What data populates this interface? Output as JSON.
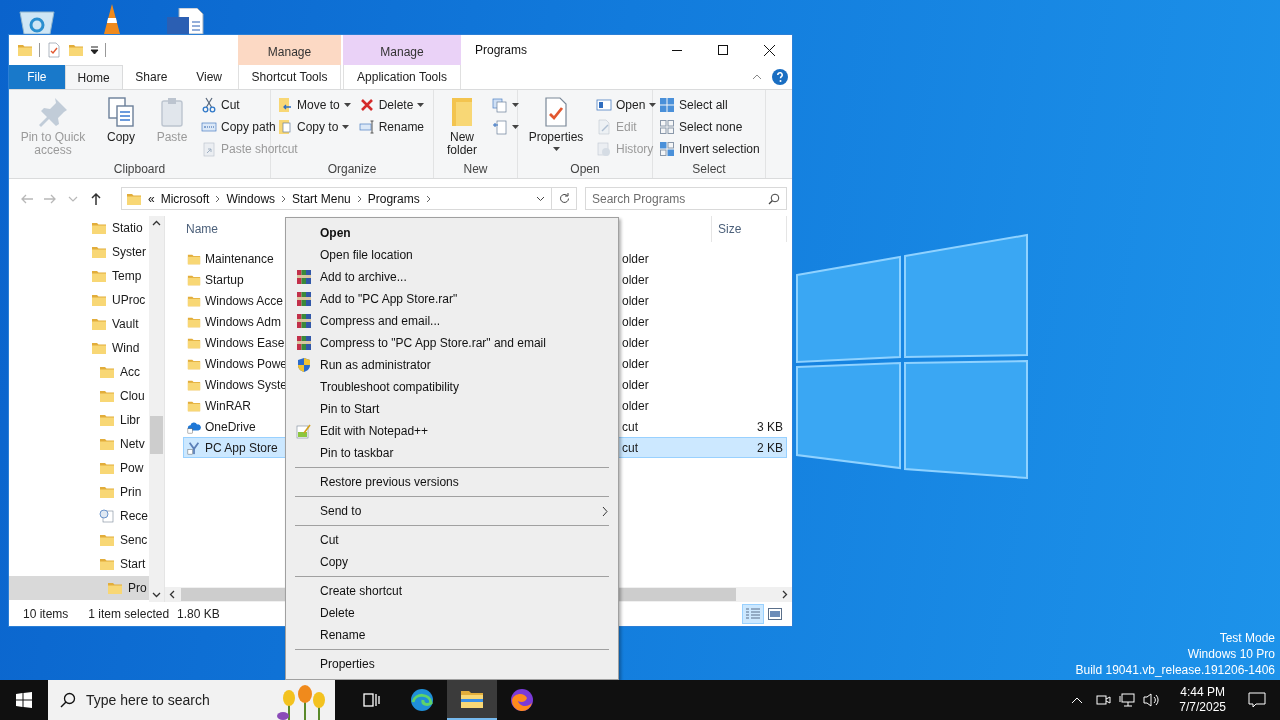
{
  "explorer": {
    "title": "Programs",
    "tabs": [
      {
        "label": "File",
        "kind": "file",
        "selected": false
      },
      {
        "label": "Home",
        "kind": "tab",
        "selected": true
      },
      {
        "label": "Share",
        "kind": "tab",
        "selected": false
      },
      {
        "label": "View",
        "kind": "tab",
        "selected": false
      }
    ],
    "contextual_tabs": [
      {
        "group": "Manage",
        "label": "Shortcut Tools",
        "color": "#fcd9c4",
        "selected": false
      },
      {
        "group": "Manage",
        "label": "Application Tools",
        "color": "#ead2f7",
        "selected": false
      }
    ],
    "ribbon": [
      {
        "label": "Clipboard",
        "columns": [
          [
            {
              "kind": "large",
              "label": "Pin to Quick access",
              "disabled": true,
              "dropdown": false
            }
          ],
          [
            {
              "kind": "large",
              "label": "Copy",
              "disabled": false,
              "dropdown": false
            }
          ],
          [
            {
              "kind": "large",
              "label": "Paste",
              "disabled": true,
              "dropdown": false
            }
          ],
          [
            {
              "kind": "small",
              "label": "Cut",
              "disabled": false,
              "dropdown": false
            },
            {
              "kind": "small",
              "label": "Copy path",
              "disabled": false,
              "dropdown": false
            },
            {
              "kind": "small",
              "label": "Paste shortcut",
              "disabled": true,
              "dropdown": false
            }
          ]
        ]
      },
      {
        "label": "Organize",
        "columns": [
          [
            {
              "kind": "small",
              "label": "Move to",
              "disabled": false,
              "dropdown": true
            },
            {
              "kind": "small",
              "label": "Copy to",
              "disabled": false,
              "dropdown": true
            }
          ],
          [
            {
              "kind": "small",
              "label": "Delete",
              "disabled": false,
              "dropdown": true
            },
            {
              "kind": "small",
              "label": "Rename",
              "disabled": false,
              "dropdown": false
            }
          ]
        ]
      },
      {
        "label": "New",
        "columns": [
          [
            {
              "kind": "large",
              "label": "New folder",
              "disabled": false,
              "dropdown": false
            }
          ],
          [
            {
              "kind": "small",
              "disabled": false,
              "dropdown": true
            },
            {
              "kind": "small",
              "disabled": false,
              "dropdown": true
            }
          ]
        ]
      },
      {
        "label": "Open",
        "columns": [
          [
            {
              "kind": "large",
              "label": "Properties",
              "disabled": false,
              "dropdown": true
            }
          ],
          [
            {
              "kind": "small",
              "label": "Open",
              "disabled": false,
              "dropdown": true
            },
            {
              "kind": "small",
              "label": "Edit",
              "disabled": true,
              "dropdown": false
            },
            {
              "kind": "small",
              "label": "History",
              "disabled": true,
              "dropdown": false
            }
          ]
        ]
      },
      {
        "label": "Select",
        "columns": [
          [
            {
              "kind": "small",
              "label": "Select all",
              "disabled": false,
              "dropdown": false
            },
            {
              "kind": "small",
              "label": "Select none",
              "disabled": false,
              "dropdown": false
            },
            {
              "kind": "small",
              "label": "Invert selection",
              "disabled": false,
              "dropdown": false
            }
          ]
        ]
      }
    ],
    "nav_buttons": [
      {
        "kind": "back",
        "disabled": true
      },
      {
        "kind": "forward",
        "disabled": true
      },
      {
        "kind": "recent",
        "disabled": true
      },
      {
        "kind": "up",
        "disabled": false
      }
    ],
    "address": {
      "overflow": "«",
      "path": [
        "Microsoft",
        "Windows",
        "Start Menu",
        "Programs"
      ]
    },
    "search": {
      "placeholder": "Search Programs"
    },
    "nav_tree": [
      {
        "label": "Statio",
        "kind": "folder",
        "selected": false
      },
      {
        "label": "Syster",
        "kind": "folder",
        "selected": false
      },
      {
        "label": "Temp",
        "kind": "folder",
        "selected": false
      },
      {
        "label": "UProc",
        "kind": "folder",
        "selected": false
      },
      {
        "label": "Vault",
        "kind": "folder",
        "selected": false
      },
      {
        "label": "Wind",
        "kind": "folder",
        "selected": false,
        "children": [
          {
            "label": "Acc",
            "kind": "folder",
            "selected": false
          },
          {
            "label": "Clou",
            "kind": "folder",
            "selected": false
          },
          {
            "label": "Libr",
            "kind": "folder",
            "selected": false
          },
          {
            "label": "Netv",
            "kind": "folder",
            "selected": false
          },
          {
            "label": "Pow",
            "kind": "folder",
            "selected": false
          },
          {
            "label": "Prin",
            "kind": "folder",
            "selected": false
          },
          {
            "label": "Rece",
            "kind": "recent",
            "selected": false
          },
          {
            "label": "Senc",
            "kind": "folder",
            "selected": false
          },
          {
            "label": "Start",
            "kind": "folder",
            "selected": false,
            "children": [
              {
                "label": "Pro",
                "kind": "folder",
                "selected": true
              }
            ]
          }
        ]
      }
    ],
    "columns": [
      "Name",
      "Size"
    ],
    "files": [
      {
        "kind": "folder",
        "name": "Maintenance",
        "column_3": "older",
        "selected": false
      },
      {
        "kind": "folder",
        "name": "Startup",
        "column_3": "older",
        "selected": false
      },
      {
        "kind": "folder",
        "name": "Windows Acce",
        "column_3": "older",
        "selected": false
      },
      {
        "kind": "folder",
        "name": "Windows Adm",
        "column_3": "older",
        "selected": false
      },
      {
        "kind": "folder",
        "name": "Windows Ease",
        "column_3": "older",
        "selected": false
      },
      {
        "kind": "folder",
        "name": "Windows Powe",
        "column_3": "older",
        "selected": false
      },
      {
        "kind": "folder",
        "name": "Windows Syste",
        "column_3": "older",
        "selected": false
      },
      {
        "kind": "folder",
        "name": "WinRAR",
        "column_3": "older",
        "selected": false
      },
      {
        "kind": "cloud",
        "name": "OneDrive",
        "column_3": "cut",
        "size": "3 KB",
        "selected": false
      },
      {
        "kind": "shortcut",
        "name": "PC App Store",
        "column_3": "cut",
        "size": "2 KB",
        "selected": true
      }
    ],
    "status": {
      "count": "10 items",
      "selection": "1 item selected",
      "size": "1.80 KB"
    },
    "views": [
      {
        "kind": "details",
        "selected": true
      },
      {
        "kind": "large-icons",
        "selected": false
      }
    ]
  },
  "context_menu": [
    {
      "kind": "plain",
      "label": "Open",
      "default": true
    },
    {
      "kind": "plain",
      "label": "Open file location",
      "default": false
    },
    {
      "kind": "archive",
      "label": "Add to archive...",
      "default": false
    },
    {
      "kind": "archive",
      "label": "Add to \"PC App Store.rar\"",
      "default": false
    },
    {
      "kind": "archive",
      "label": "Compress and email...",
      "default": false
    },
    {
      "kind": "archive",
      "label": "Compress to \"PC App Store.rar\" and email",
      "default": false
    },
    {
      "kind": "shield",
      "label": "Run as administrator",
      "default": false
    },
    {
      "kind": "plain",
      "label": "Troubleshoot compatibility",
      "default": false
    },
    {
      "kind": "plain",
      "label": "Pin to Start",
      "default": false
    },
    {
      "kind": "editor",
      "label": "Edit with Notepad++",
      "default": false
    },
    {
      "kind": "plain",
      "label": "Pin to taskbar",
      "default": false
    },
    {
      "kind": "separator"
    },
    {
      "kind": "plain",
      "label": "Restore previous versions",
      "default": false
    },
    {
      "kind": "separator"
    },
    {
      "kind": "submenu",
      "label": "Send to",
      "default": false
    },
    {
      "kind": "separator"
    },
    {
      "kind": "plain",
      "label": "Cut",
      "default": false
    },
    {
      "kind": "plain",
      "label": "Copy",
      "default": false
    },
    {
      "kind": "separator"
    },
    {
      "kind": "plain",
      "label": "Create shortcut",
      "default": false
    },
    {
      "kind": "plain",
      "label": "Delete",
      "default": false
    },
    {
      "kind": "plain",
      "label": "Rename",
      "default": false
    },
    {
      "kind": "separator"
    },
    {
      "kind": "plain",
      "label": "Properties",
      "default": false
    }
  ],
  "desktop_text": [
    "Test Mode",
    "Windows 10 Pro",
    "Build 19041.vb_release.191206-1406"
  ],
  "taskbar": {
    "search_placeholder": "Type here to search",
    "apps": [
      {
        "kind": "task-view",
        "active": false
      },
      {
        "kind": "swirl",
        "active": false
      },
      {
        "kind": "folder",
        "active": true
      },
      {
        "kind": "fox",
        "active": false
      }
    ],
    "time": "4:44 PM",
    "date": "7/7/2025"
  }
}
